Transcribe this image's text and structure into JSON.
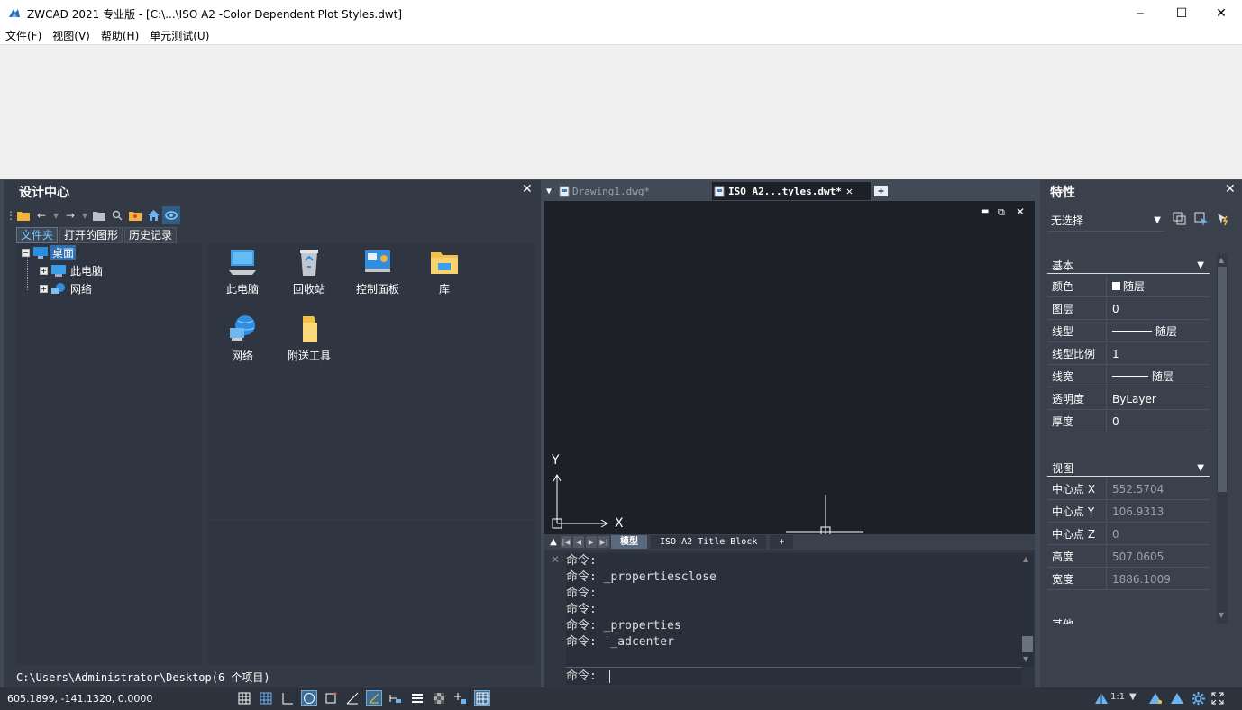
{
  "window": {
    "title": "ZWCAD 2021 专业版 - [C:\\...\\ISO A2 -Color Dependent Plot Styles.dwt]",
    "minimize": "─",
    "maximize": "☐",
    "close": "✕"
  },
  "menu": {
    "items": [
      {
        "label": "文件(F)"
      },
      {
        "label": "视图(V)"
      },
      {
        "label": "帮助(H)"
      },
      {
        "label": "单元测试(U)"
      }
    ]
  },
  "design_center": {
    "title": "设计中心",
    "close": "✕",
    "tabs": [
      "文件夹",
      "打开的图形",
      "历史记录"
    ],
    "tree": {
      "root": "桌面",
      "children": [
        "此电脑",
        "网络"
      ]
    },
    "items": [
      "此电脑",
      "回收站",
      "控制面板",
      "库",
      "网络",
      "附送工具"
    ],
    "status": "C:\\Users\\Administrator\\Desktop(6 个项目)"
  },
  "doc_tabs": {
    "tabs": [
      {
        "label": "Drawing1.dwg*"
      },
      {
        "label": "ISO A2...tyles.dwt*"
      }
    ],
    "tab_close": "✕"
  },
  "canvas": {
    "axis_y": "Y",
    "axis_x": "X",
    "win_min": "▬",
    "win_restore": "⧉",
    "win_close": "✕"
  },
  "layouts": {
    "tabs": [
      "模型",
      "ISO A2 Title Block",
      "+"
    ]
  },
  "command": {
    "history": [
      "命令:",
      "命令: _propertiesclose",
      "命令:",
      "命令:",
      "命令: _properties",
      "命令: '_adcenter"
    ],
    "prompt": "命令:",
    "close": "✕"
  },
  "properties": {
    "title": "特性",
    "close": "✕",
    "selection": "无选择",
    "sections": [
      {
        "name": "基本",
        "rows": [
          {
            "label": "颜色",
            "value": "随层",
            "swatch": true
          },
          {
            "label": "图层",
            "value": "0"
          },
          {
            "label": "线型",
            "value": "随层",
            "line": true
          },
          {
            "label": "线型比例",
            "value": "1"
          },
          {
            "label": "线宽",
            "value": "随层",
            "line": true
          },
          {
            "label": "透明度",
            "value": "ByLayer"
          },
          {
            "label": "厚度",
            "value": "0"
          }
        ]
      },
      {
        "name": "视图",
        "rows": [
          {
            "label": "中心点 X",
            "value": "552.5704"
          },
          {
            "label": "中心点 Y",
            "value": "106.9313"
          },
          {
            "label": "中心点 Z",
            "value": "0"
          },
          {
            "label": "高度",
            "value": "507.0605"
          },
          {
            "label": "宽度",
            "value": "1886.1009"
          }
        ]
      },
      {
        "name": "其他",
        "rows": []
      }
    ]
  },
  "statusbar": {
    "coords": "605.1899,  -141.1320,  0.0000",
    "scale": "1:1"
  },
  "colors": {
    "panel_bg": "#333a45",
    "canvas_bg": "#1d2027",
    "accent": "#2f5f86"
  }
}
